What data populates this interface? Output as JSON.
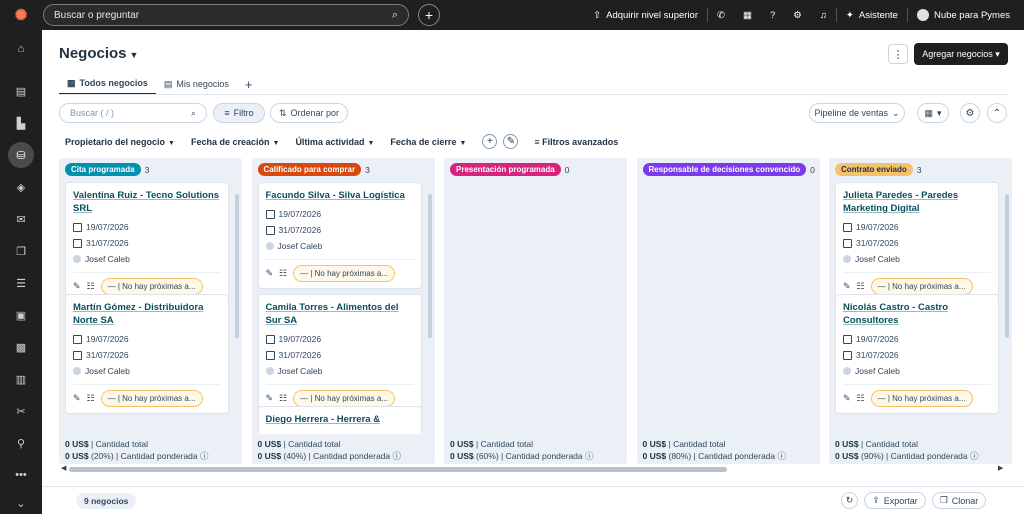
{
  "topbar": {
    "search_placeholder": "Buscar o preguntar",
    "upgrade": "Adquirir nivel superior",
    "assistant": "Asistente",
    "account": "Nube para Pymes"
  },
  "page": {
    "title": "Negocios",
    "create_button": "Agregar negocios"
  },
  "tabs": [
    {
      "label": "Todos negocios"
    },
    {
      "label": "Mis negocios"
    }
  ],
  "toolbar": {
    "search_placeholder": "Buscar ( / )",
    "filter": "Filtro",
    "sort": "Ordenar por",
    "pipeline": "Pipeline de ventas"
  },
  "filters": {
    "owner": "Propietario del negocio",
    "created": "Fecha de creación",
    "activity": "Última actividad",
    "close": "Fecha de cierre",
    "advanced": "Filtros avanzados"
  },
  "columns": [
    {
      "stage": "Cita programada",
      "count": "3",
      "color": "#0091ae",
      "text_color": "#ffffff",
      "total": "0 US$",
      "total_label": "| Cantidad total",
      "weighted": "0 US$",
      "weighted_label": "(20%) | Cantidad ponderada ⓘ",
      "cards": [
        {
          "title": "Valentina Ruiz - Tecno Solutions SRL",
          "created": "19/07/2026",
          "close": "31/07/2026",
          "owner": "Josef Caleb",
          "task": "No hay próximas a..."
        },
        {
          "title": "Martín Gómez - Distribuidora Norte SA",
          "created": "19/07/2026",
          "close": "31/07/2026",
          "owner": "Josef Caleb",
          "task": "No hay próximas a..."
        }
      ]
    },
    {
      "stage": "Calificado para comprar",
      "count": "3",
      "color": "#d9480f",
      "text_color": "#ffffff",
      "total": "0 US$",
      "total_label": "| Cantidad total",
      "weighted": "0 US$",
      "weighted_label": "(40%) | Cantidad ponderada ⓘ",
      "cards": [
        {
          "title": "Facundo Silva - Silva Logística",
          "created": "19/07/2026",
          "close": "31/07/2026",
          "owner": "Josef Caleb",
          "task": "No hay próximas a..."
        },
        {
          "title": "Camila Torres - Alimentos del Sur SA",
          "created": "19/07/2026",
          "close": "31/07/2026",
          "owner": "Josef Caleb",
          "task": "No hay próximas a..."
        },
        {
          "title": "Diego Herrera - Herrera &"
        }
      ]
    },
    {
      "stage": "Presentación programada",
      "count": "0",
      "color": "#d6247f",
      "text_color": "#ffffff",
      "total": "0 US$",
      "total_label": "| Cantidad total",
      "weighted": "0 US$",
      "weighted_label": "(60%) | Cantidad ponderada ⓘ",
      "cards": []
    },
    {
      "stage": "Responsable de decisiones convencido",
      "count": "0",
      "color": "#7c3aed",
      "text_color": "#ffffff",
      "total": "0 US$",
      "total_label": "| Cantidad total",
      "weighted": "0 US$",
      "weighted_label": "(80%) | Cantidad ponderada ⓘ",
      "cards": []
    },
    {
      "stage": "Contrato enviado",
      "count": "3",
      "color": "#f5c26b",
      "text_color": "#213343",
      "total": "0 US$",
      "total_label": "| Cantidad total",
      "weighted": "0 US$",
      "weighted_label": "(90%) | Cantidad ponderada ⓘ",
      "cards": [
        {
          "title": "Julieta Paredes - Paredes Marketing Digital",
          "created": "19/07/2026",
          "close": "31/07/2026",
          "owner": "Josef Caleb",
          "task": "No hay próximas a..."
        },
        {
          "title": "Nicolás Castro - Castro Consultores",
          "created": "19/07/2026",
          "close": "31/07/2026",
          "owner": "Josef Caleb",
          "task": "No hay próximas a..."
        }
      ]
    }
  ],
  "footer": {
    "count": "9 negocios",
    "export": "Exportar",
    "clone": "Clonar"
  }
}
